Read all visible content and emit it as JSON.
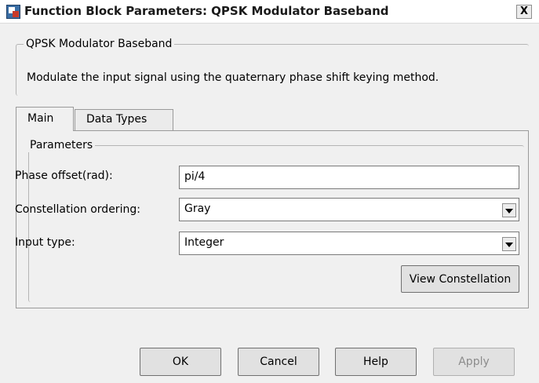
{
  "window": {
    "title": "Function Block Parameters: QPSK Modulator Baseband",
    "close_label": "X"
  },
  "description": {
    "group_title": "QPSK Modulator Baseband",
    "text": "Modulate the input signal using the quaternary phase shift keying method."
  },
  "tabs": [
    {
      "label": "Main",
      "active": true
    },
    {
      "label": "Data Types",
      "active": false
    }
  ],
  "parameters": {
    "group_title": "Parameters",
    "phase_offset": {
      "label": "Phase offset(rad):",
      "value": "pi/4"
    },
    "constellation_ordering": {
      "label": "Constellation ordering:",
      "value": "Gray"
    },
    "input_type": {
      "label": "Input type:",
      "value": "Integer"
    },
    "view_constellation_label": "View Constellation"
  },
  "buttons": {
    "ok": "OK",
    "cancel": "Cancel",
    "help": "Help",
    "apply": "Apply"
  }
}
